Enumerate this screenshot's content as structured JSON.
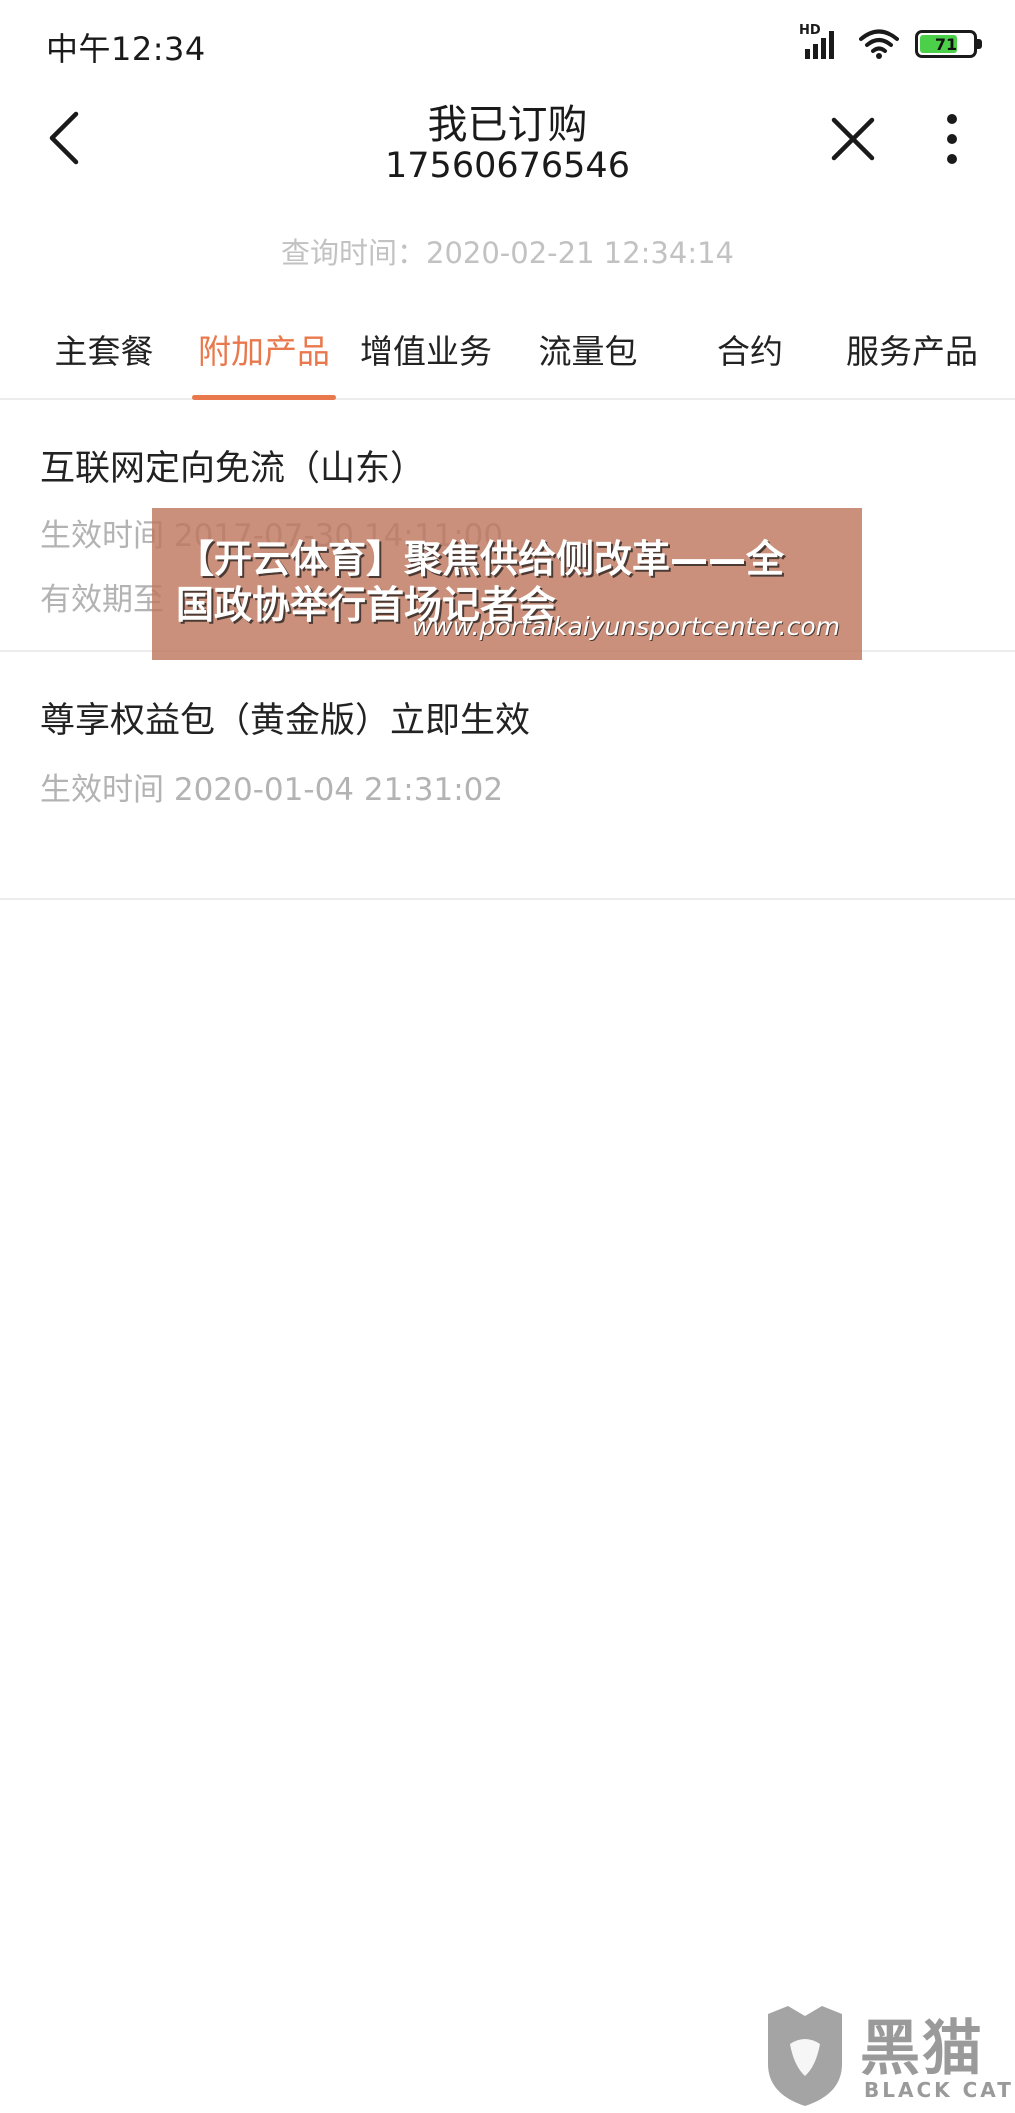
{
  "status_bar": {
    "time": "中午12:34",
    "network_label": "HD",
    "battery_level": "71",
    "battery_fraction": 0.71,
    "icons": [
      "hd-signal-icon",
      "wifi-icon",
      "battery-icon"
    ]
  },
  "header": {
    "title": "我已订购",
    "phone": "17560676546",
    "back_icon": "chevron-left-icon",
    "close_icon": "close-icon",
    "more_icon": "more-vertical-icon"
  },
  "query_time": "查询时间：2020-02-21 12:34:14",
  "tabs": [
    {
      "label": "主套餐",
      "active": false
    },
    {
      "label": "附加产品",
      "active": true
    },
    {
      "label": "增值业务",
      "active": false
    },
    {
      "label": "流量包",
      "active": false
    },
    {
      "label": "合约",
      "active": false
    },
    {
      "label": "服务产品",
      "active": false
    }
  ],
  "products": [
    {
      "title": "互联网定向免流（山东）",
      "effective_time": "生效时间 2017-07-30 14:11:00",
      "valid_until": "有效期至"
    },
    {
      "title": "尊享权益包（黄金版）立即生效",
      "effective_time": "生效时间 2020-01-04 21:31:02"
    }
  ],
  "overlay": {
    "line1": "【开云体育】聚焦供给侧改革——全",
    "line2": "国政协举行首场记者会",
    "url": "www.portalkaiyunsportcenter.com"
  },
  "watermark": {
    "cn": "黑猫",
    "en": "BLACK CAT",
    "icon": "black-cat-logo-icon"
  },
  "colors": {
    "accent": "#e9794d",
    "text_primary": "#222222",
    "text_secondary": "#b3b3b3",
    "divider": "#ececec",
    "battery_fill": "#4cd04a"
  }
}
